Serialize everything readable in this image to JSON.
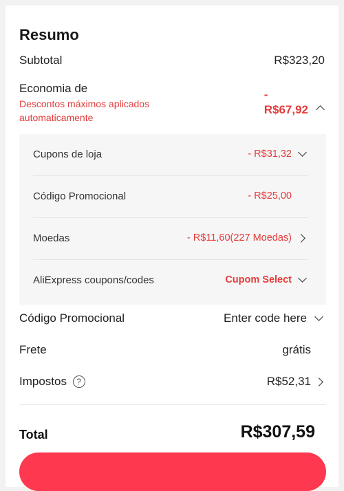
{
  "summary": {
    "title": "Resumo",
    "subtotal_label": "Subtotal",
    "subtotal_value": "R$323,20",
    "economy_label": "Economia de",
    "economy_note": "Descontos máximos aplicados automaticamente",
    "economy_value_sign": "-",
    "economy_value": "R$67,92",
    "discounts": [
      {
        "label": "Cupons de loja",
        "value": "- R$31,32",
        "icon": "chevron-down-icon"
      },
      {
        "label": "Código Promocional",
        "value": "- R$25,00",
        "icon": ""
      },
      {
        "label": "Moedas",
        "value": "- R$11,60(227 Moedas)",
        "icon": "chevron-right-icon"
      },
      {
        "label": "AliExpress coupons/codes",
        "value": "Cupom Select",
        "icon": "chevron-down-icon"
      }
    ],
    "promo_label": "Código Promocional",
    "promo_placeholder": "Enter code here",
    "shipping_label": "Frete",
    "shipping_value": "grátis",
    "taxes_label": "Impostos",
    "taxes_help": "?",
    "taxes_value": "R$52,31",
    "total_label": "Total",
    "total_value": "R$307,59"
  },
  "colors": {
    "accent_red": "#e43b3b",
    "cta_red": "#fd384f"
  }
}
